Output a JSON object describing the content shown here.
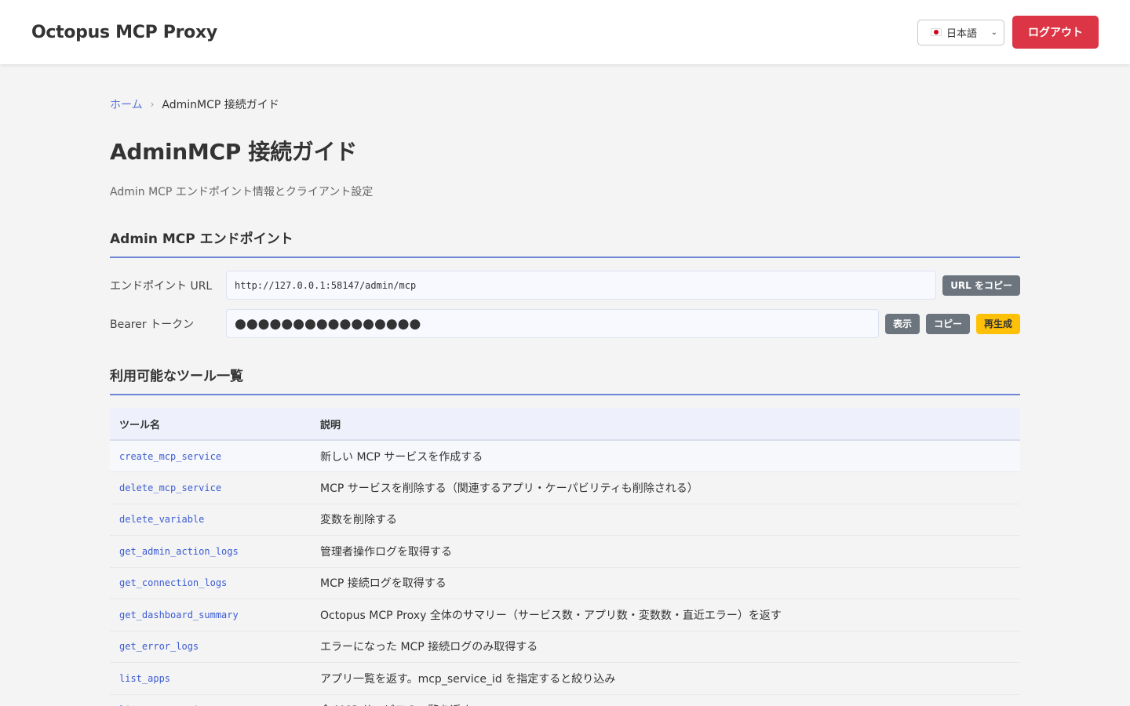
{
  "header": {
    "app_title": "Octopus MCP Proxy",
    "language": "日本語",
    "logout_label": "ログアウト"
  },
  "breadcrumb": {
    "home": "ホーム",
    "separator": "›",
    "current": "AdminMCP 接続ガイド"
  },
  "page": {
    "title": "AdminMCP 接続ガイド",
    "subtitle": "Admin MCP エンドポイント情報とクライアント設定"
  },
  "endpoint_section": {
    "title": "Admin MCP エンドポイント",
    "url_label": "エンドポイント URL",
    "url_value": "http://127.0.0.1:58147/admin/mcp",
    "copy_url_label": "URL をコピー",
    "token_label": "Bearer トークン",
    "token_value": "●●●●●●●●●●●●●●●●",
    "show_label": "表示",
    "copy_label": "コピー",
    "regenerate_label": "再生成"
  },
  "tools_section": {
    "title": "利用可能なツール一覧",
    "col_name": "ツール名",
    "col_desc": "説明",
    "rows": [
      {
        "name": "create_mcp_service",
        "desc": "新しい MCP サービスを作成する"
      },
      {
        "name": "delete_mcp_service",
        "desc": "MCP サービスを削除する（関連するアプリ・ケーパビリティも削除される）"
      },
      {
        "name": "delete_variable",
        "desc": "変数を削除する"
      },
      {
        "name": "get_admin_action_logs",
        "desc": "管理者操作ログを取得する"
      },
      {
        "name": "get_connection_logs",
        "desc": "MCP 接続ログを取得する"
      },
      {
        "name": "get_dashboard_summary",
        "desc": "Octopus MCP Proxy 全体のサマリー（サービス数・アプリ数・変数数・直近エラー）を返す"
      },
      {
        "name": "get_error_logs",
        "desc": "エラーになった MCP 接続ログのみ取得する"
      },
      {
        "name": "list_apps",
        "desc": "アプリ一覧を返す。mcp_service_id を指定すると絞り込み"
      },
      {
        "name": "list_mcp_services",
        "desc": "全 MCP サービスの一覧を返す"
      }
    ]
  },
  "colors": {
    "accent": "#6f86d6",
    "danger": "#dc3545",
    "warning": "#ffc107",
    "secondary": "#6c757d",
    "link": "#3b5bd1"
  }
}
